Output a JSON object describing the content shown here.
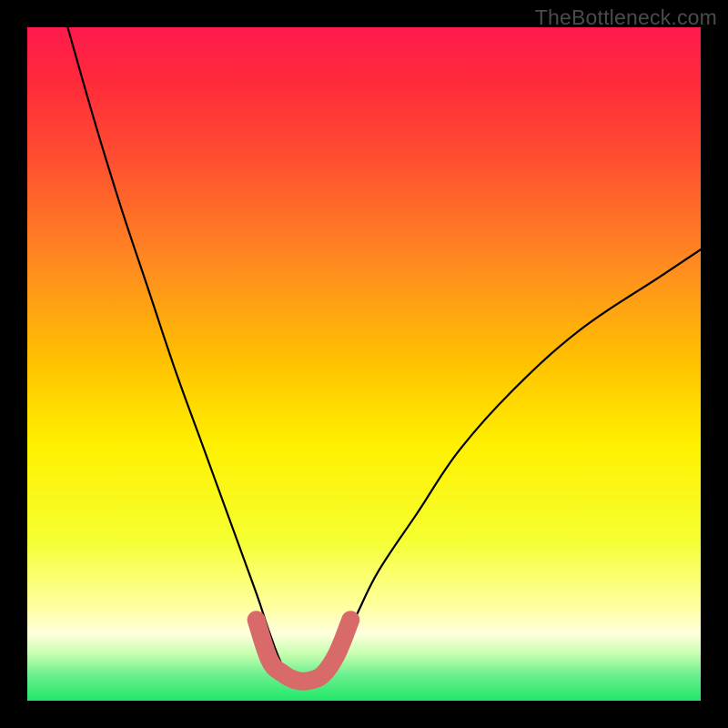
{
  "watermark": "TheBottleneck.com",
  "chart_data": {
    "type": "line",
    "title": "",
    "xlabel": "",
    "ylabel": "",
    "xlim": [
      0,
      100
    ],
    "ylim": [
      0,
      100
    ],
    "grid": false,
    "legend": false,
    "series": [
      {
        "name": "bottleneck-curve",
        "x": [
          6,
          10,
          14,
          18,
          22,
          26,
          30,
          34,
          36,
          38,
          40,
          42,
          44,
          48,
          52,
          58,
          64,
          72,
          82,
          94,
          100
        ],
        "y": [
          100,
          86,
          73,
          61,
          49,
          38,
          27,
          16,
          10,
          5,
          3,
          3,
          5,
          11,
          19,
          28,
          37,
          46,
          55,
          63,
          67
        ]
      },
      {
        "name": "sweet-spot-marker",
        "x": [
          34,
          36,
          38,
          40,
          42,
          44,
          46,
          48
        ],
        "y": [
          12,
          6,
          4,
          3,
          3,
          4,
          7,
          12
        ]
      }
    ],
    "gradient_stops": [
      {
        "offset": 0.0,
        "color": "#ff1a4d"
      },
      {
        "offset": 0.08,
        "color": "#ff2a3a"
      },
      {
        "offset": 0.2,
        "color": "#ff5030"
      },
      {
        "offset": 0.35,
        "color": "#ff8a20"
      },
      {
        "offset": 0.5,
        "color": "#ffc300"
      },
      {
        "offset": 0.62,
        "color": "#fff000"
      },
      {
        "offset": 0.76,
        "color": "#f5ff30"
      },
      {
        "offset": 0.86,
        "color": "#ffffa0"
      },
      {
        "offset": 0.9,
        "color": "#ffffdd"
      },
      {
        "offset": 0.93,
        "color": "#c8ffb0"
      },
      {
        "offset": 0.96,
        "color": "#70f090"
      },
      {
        "offset": 1.0,
        "color": "#20e868"
      }
    ],
    "curve_color": "#000000",
    "marker_color": "#d96a6a"
  }
}
